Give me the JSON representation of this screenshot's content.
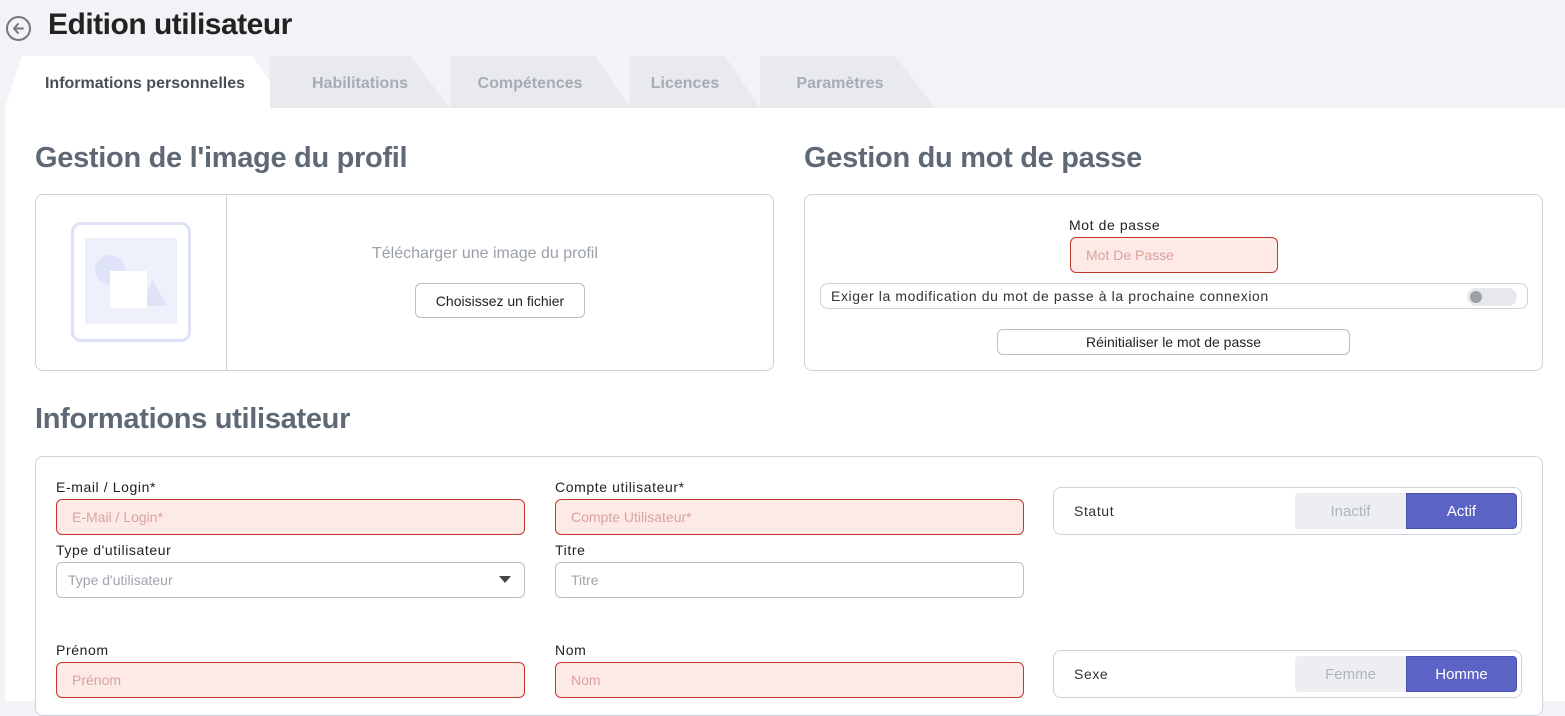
{
  "header": {
    "title": "Edition utilisateur"
  },
  "tabs": [
    {
      "label": "Informations personnelles"
    },
    {
      "label": "Habilitations"
    },
    {
      "label": "Compétences"
    },
    {
      "label": "Licences"
    },
    {
      "label": "Paramètres"
    }
  ],
  "profile_image": {
    "title": "Gestion de l'image du profil",
    "upload_text": "Télécharger une image du profil",
    "choose_file_label": "Choisissez un fichier"
  },
  "password": {
    "title": "Gestion du mot de passe",
    "field_label": "Mot de passe",
    "field_placeholder": "Mot De Passe",
    "field_value": "",
    "require_change_label": "Exiger la modification du mot de passe à la prochaine connexion",
    "require_change_on": false,
    "reset_label": "Réinitialiser le mot de passe"
  },
  "user_info": {
    "title": "Informations utilisateur",
    "email": {
      "label": "E-mail / Login*",
      "placeholder": "E-Mail / Login*",
      "value": ""
    },
    "account": {
      "label": "Compte utilisateur*",
      "placeholder": "Compte Utilisateur*",
      "value": ""
    },
    "user_type": {
      "label": "Type d'utilisateur",
      "placeholder": "Type d'utilisateur",
      "value": ""
    },
    "title_field": {
      "label": "Titre",
      "placeholder": "Titre",
      "value": ""
    },
    "firstname": {
      "label": "Prénom",
      "placeholder": "Prénom",
      "value": ""
    },
    "lastname": {
      "label": "Nom",
      "placeholder": "Nom",
      "value": ""
    },
    "status": {
      "label": "Statut",
      "off": "Inactif",
      "on": "Actif",
      "selected": "Actif"
    },
    "sex": {
      "label": "Sexe",
      "off": "Femme",
      "on": "Homme",
      "selected": "Homme"
    }
  },
  "colors": {
    "accent": "#5b63c4",
    "error_border": "#c0392b",
    "error_bg": "#fde9e6"
  }
}
